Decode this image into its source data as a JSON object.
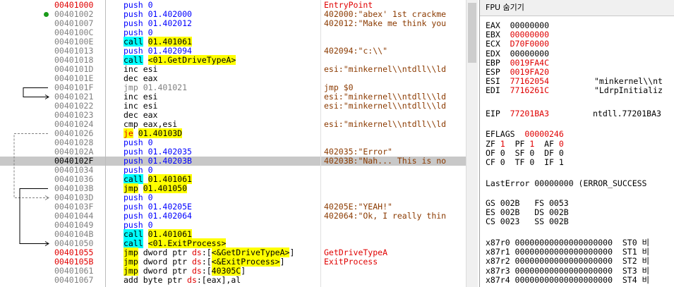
{
  "disasm": {
    "rows": [
      {
        "addr": "00401000",
        "addr_red": true,
        "dot": false,
        "sel": false,
        "instr": [
          {
            "t": "push ",
            "c": "kw-blue"
          },
          {
            "t": "0",
            "c": "kw-blue"
          }
        ],
        "cmt": "EntryPoint",
        "cmt_color": "#e00000"
      },
      {
        "addr": "00401002",
        "dot": true,
        "instr": [
          {
            "t": "push ",
            "c": "kw-blue"
          },
          {
            "t": "01.402000",
            "c": "kw-blue"
          }
        ],
        "cmt": "402000:\"abex' 1st crackme"
      },
      {
        "addr": "00401007",
        "instr": [
          {
            "t": "push ",
            "c": "kw-blue"
          },
          {
            "t": "01.402012",
            "c": "kw-blue"
          }
        ],
        "cmt": "402012:\"Make me think you"
      },
      {
        "addr": "0040100C",
        "instr": [
          {
            "t": "push ",
            "c": "kw-blue"
          },
          {
            "t": "0",
            "c": "kw-blue"
          }
        ],
        "cmt": ""
      },
      {
        "addr": "0040100E",
        "instr": [
          {
            "t": "call",
            "c": "hl-cyan"
          },
          {
            "t": " "
          },
          {
            "t": "01.401061",
            "c": "hl-yellow"
          }
        ],
        "cmt": ""
      },
      {
        "addr": "00401013",
        "instr": [
          {
            "t": "push ",
            "c": "kw-blue"
          },
          {
            "t": "01.402094",
            "c": "kw-blue"
          }
        ],
        "cmt": "402094:\"c:\\\\\""
      },
      {
        "addr": "00401018",
        "instr": [
          {
            "t": "call",
            "c": "hl-cyan"
          },
          {
            "t": " "
          },
          {
            "t": "<01.GetDriveTypeA>",
            "c": "hl-yellow"
          }
        ],
        "cmt": ""
      },
      {
        "addr": "0040101D",
        "instr": [
          {
            "t": "inc esi"
          }
        ],
        "cmt": "esi:\"minkernel\\\\ntdll\\\\ld"
      },
      {
        "addr": "0040101E",
        "instr": [
          {
            "t": "dec eax"
          }
        ],
        "cmt": ""
      },
      {
        "addr": "0040101F",
        "instr": [
          {
            "t": "jmp 01.401021",
            "c": "kw-gray"
          }
        ],
        "cmt": "jmp $0"
      },
      {
        "addr": "00401021",
        "instr": [
          {
            "t": "inc esi"
          }
        ],
        "cmt": "esi:\"minkernel\\\\ntdll\\\\ld"
      },
      {
        "addr": "00401022",
        "instr": [
          {
            "t": "inc esi"
          }
        ],
        "cmt": "esi:\"minkernel\\\\ntdll\\\\ld"
      },
      {
        "addr": "00401023",
        "instr": [
          {
            "t": "dec eax"
          }
        ],
        "cmt": ""
      },
      {
        "addr": "00401024",
        "instr": [
          {
            "t": "cmp eax,esi"
          }
        ],
        "cmt": "esi:\"minkernel\\\\ntdll\\\\ld"
      },
      {
        "addr": "00401026",
        "instr": [
          {
            "t": "je",
            "c": "hl-yellow-red"
          },
          {
            "t": " "
          },
          {
            "t": "01.40103D",
            "c": "hl-yellow"
          }
        ],
        "cmt": ""
      },
      {
        "addr": "00401028",
        "instr": [
          {
            "t": "push ",
            "c": "kw-blue"
          },
          {
            "t": "0",
            "c": "kw-blue"
          }
        ],
        "cmt": ""
      },
      {
        "addr": "0040102A",
        "instr": [
          {
            "t": "push ",
            "c": "kw-blue"
          },
          {
            "t": "01.402035",
            "c": "kw-blue"
          }
        ],
        "cmt": "402035:\"Error\""
      },
      {
        "addr": "0040102F",
        "sel": true,
        "instr": [
          {
            "t": "push ",
            "c": "kw-blue"
          },
          {
            "t": "01.40203B",
            "c": "kw-blue"
          }
        ],
        "cmt": "40203B:\"Nah... This is no"
      },
      {
        "addr": "00401034",
        "instr": [
          {
            "t": "push ",
            "c": "kw-blue"
          },
          {
            "t": "0",
            "c": "kw-blue"
          }
        ],
        "cmt": ""
      },
      {
        "addr": "00401036",
        "instr": [
          {
            "t": "call",
            "c": "hl-cyan"
          },
          {
            "t": " "
          },
          {
            "t": "01.401061",
            "c": "hl-yellow"
          }
        ],
        "cmt": ""
      },
      {
        "addr": "0040103B",
        "instr": [
          {
            "t": "jmp",
            "c": "hl-jmp"
          },
          {
            "t": " "
          },
          {
            "t": "01.401050",
            "c": "hl-yellow"
          }
        ],
        "cmt": ""
      },
      {
        "addr": "0040103D",
        "instr": [
          {
            "t": "push ",
            "c": "kw-blue"
          },
          {
            "t": "0",
            "c": "kw-blue"
          }
        ],
        "cmt": ""
      },
      {
        "addr": "0040103F",
        "instr": [
          {
            "t": "push ",
            "c": "kw-blue"
          },
          {
            "t": "01.40205E",
            "c": "kw-blue"
          }
        ],
        "cmt": "40205E:\"YEAH!\""
      },
      {
        "addr": "00401044",
        "instr": [
          {
            "t": "push ",
            "c": "kw-blue"
          },
          {
            "t": "01.402064",
            "c": "kw-blue"
          }
        ],
        "cmt": "402064:\"Ok, I really thin"
      },
      {
        "addr": "00401049",
        "instr": [
          {
            "t": "push ",
            "c": "kw-blue"
          },
          {
            "t": "0",
            "c": "kw-blue"
          }
        ],
        "cmt": ""
      },
      {
        "addr": "0040104B",
        "instr": [
          {
            "t": "call",
            "c": "hl-cyan"
          },
          {
            "t": " "
          },
          {
            "t": "01.401061",
            "c": "hl-yellow"
          }
        ],
        "cmt": ""
      },
      {
        "addr": "00401050",
        "instr": [
          {
            "t": "call",
            "c": "hl-cyan"
          },
          {
            "t": " "
          },
          {
            "t": "<01.ExitProcess>",
            "c": "hl-yellow"
          }
        ],
        "cmt": ""
      },
      {
        "addr": "00401055",
        "addr_red": true,
        "instr": [
          {
            "t": "jmp",
            "c": "hl-jmp"
          },
          {
            "t": " dword ptr "
          },
          {
            "t": "ds",
            "c": "kw-red"
          },
          {
            "t": ":["
          },
          {
            "t": "<&GetDriveTypeA>",
            "c": "hl-yellow"
          },
          {
            "t": "]"
          }
        ],
        "cmt": "GetDriveTypeA",
        "cmt_color": "#e00000"
      },
      {
        "addr": "0040105B",
        "addr_red": true,
        "instr": [
          {
            "t": "jmp",
            "c": "hl-jmp"
          },
          {
            "t": " dword ptr "
          },
          {
            "t": "ds",
            "c": "kw-red"
          },
          {
            "t": ":["
          },
          {
            "t": "<&ExitProcess>",
            "c": "hl-yellow"
          },
          {
            "t": "]"
          }
        ],
        "cmt": "ExitProcess",
        "cmt_color": "#e00000"
      },
      {
        "addr": "00401061",
        "instr": [
          {
            "t": "jmp",
            "c": "hl-jmp"
          },
          {
            "t": " dword ptr "
          },
          {
            "t": "ds",
            "c": "kw-red"
          },
          {
            "t": ":["
          },
          {
            "t": "40305C",
            "c": "hl-yellow"
          },
          {
            "t": "]"
          }
        ],
        "cmt": ""
      },
      {
        "addr": "00401067",
        "instr": [
          {
            "t": "add byte ptr "
          },
          {
            "t": "ds",
            "c": "kw-red"
          },
          {
            "t": ":[eax],al"
          }
        ],
        "cmt": ""
      }
    ]
  },
  "regs": {
    "fpu_button": "FPU 숨기기",
    "lines": [
      {
        "name": "EAX",
        "val": "00000000",
        "red": false,
        "extra": ""
      },
      {
        "name": "EBX",
        "val": "00000000",
        "red": true,
        "extra": ""
      },
      {
        "name": "ECX",
        "val": "D70F0000",
        "red": true,
        "extra": ""
      },
      {
        "name": "EDX",
        "val": "00000000",
        "red": false,
        "extra": ""
      },
      {
        "name": "EBP",
        "val": "0019FA4C",
        "red": true,
        "extra": ""
      },
      {
        "name": "ESP",
        "val": "0019FA20",
        "red": true,
        "extra": ""
      },
      {
        "name": "ESI",
        "val": "77162054",
        "red": true,
        "extra": "\"minkernel\\\\nt"
      },
      {
        "name": "EDI",
        "val": "7716261C",
        "red": true,
        "extra": "\"LdrpInitializ"
      }
    ],
    "eip": {
      "name": "EIP",
      "val": "77201BA3",
      "extra": "ntdll.77201BA3"
    },
    "eflags": {
      "name": "EFLAGS",
      "val": "00000246"
    },
    "flags": [
      [
        {
          "n": "ZF",
          "v": "1",
          "red": true
        },
        {
          "n": "PF",
          "v": "1",
          "red": true
        },
        {
          "n": "AF",
          "v": "0",
          "red": true
        }
      ],
      [
        {
          "n": "OF",
          "v": "0",
          "red": false
        },
        {
          "n": "SF",
          "v": "0",
          "red": false
        },
        {
          "n": "DF",
          "v": "0",
          "red": false
        }
      ],
      [
        {
          "n": "CF",
          "v": "0",
          "red": false
        },
        {
          "n": "TF",
          "v": "0",
          "red": false
        },
        {
          "n": "IF",
          "v": "1",
          "red": false
        }
      ]
    ],
    "lasterror": "LastError 00000000 (ERROR_SUCCESS",
    "segs": [
      "GS 002B   FS 0053",
      "ES 002B   DS 002B",
      "CS 0023   SS 002B"
    ],
    "x87": [
      {
        "n": "x87r0",
        "v": "00000000000000000000",
        "st": "ST0 비"
      },
      {
        "n": "x87r1",
        "v": "00000000000000000000",
        "st": "ST1 비"
      },
      {
        "n": "x87r2",
        "v": "00000000000000000000",
        "st": "ST2 비"
      },
      {
        "n": "x87r3",
        "v": "00000000000000000000",
        "st": "ST3 비"
      },
      {
        "n": "x87r4",
        "v": "00000000000000000000",
        "st": "ST4 비"
      }
    ]
  }
}
